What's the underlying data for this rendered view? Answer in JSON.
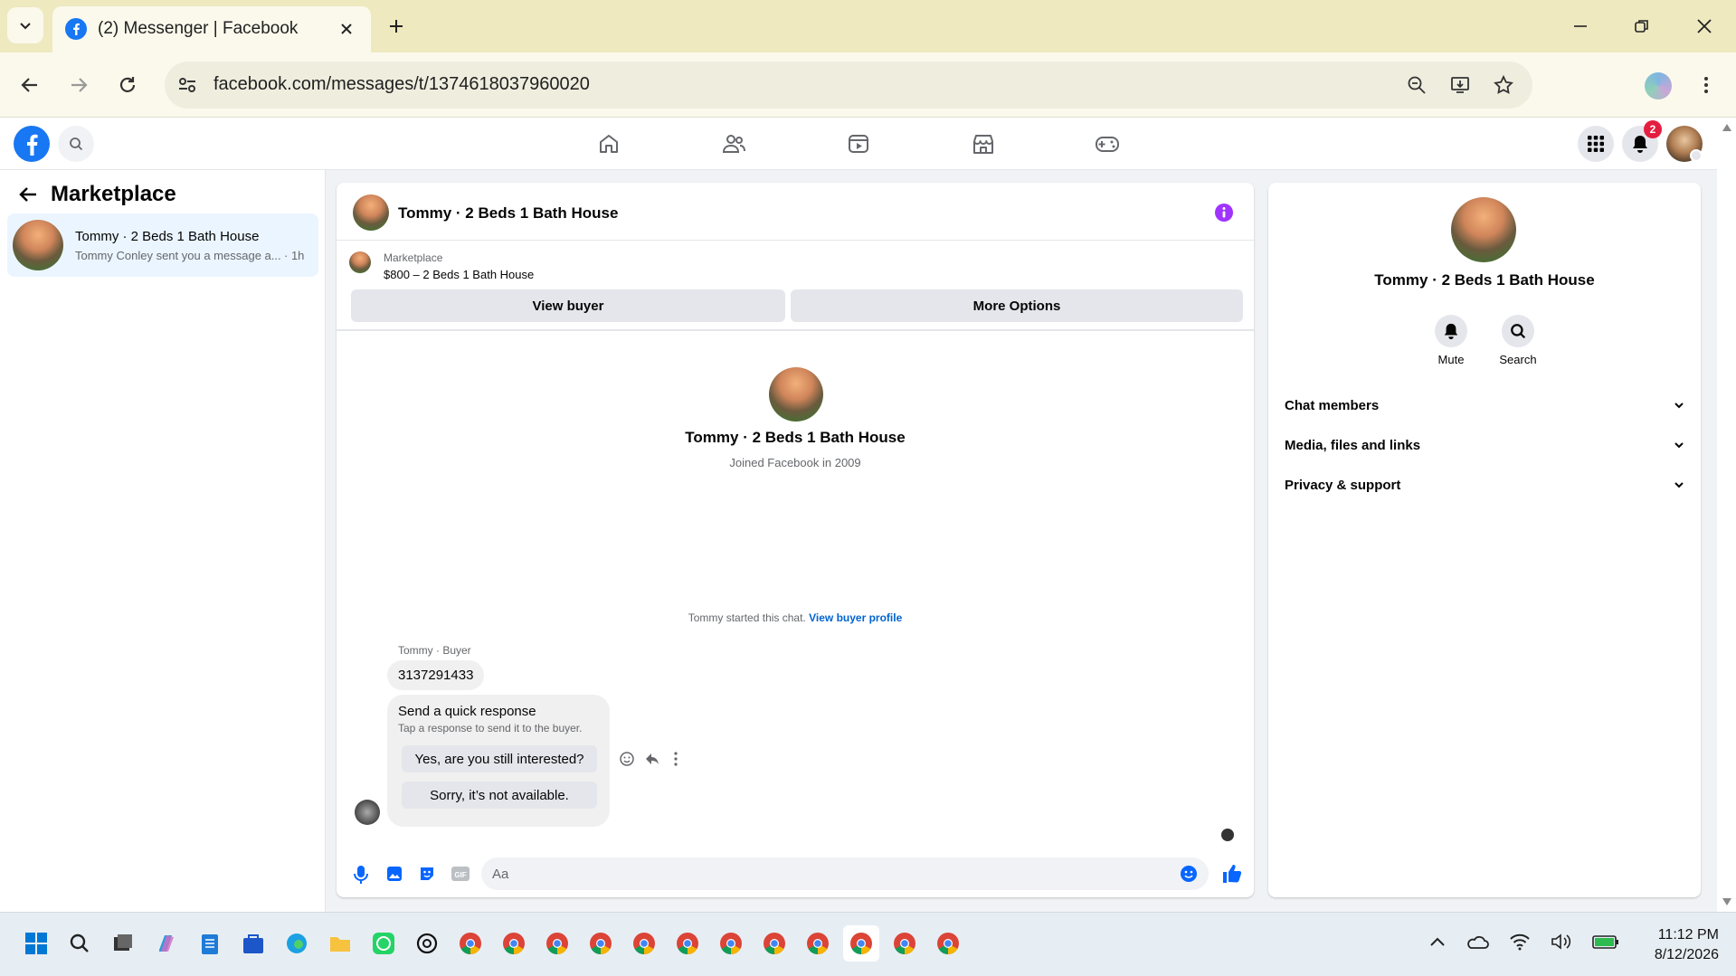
{
  "browser": {
    "tab_title": "(2) Messenger | Facebook",
    "url": "facebook.com/messages/t/1374618037960020"
  },
  "header": {
    "notifications_count": "2"
  },
  "left": {
    "title": "Marketplace",
    "chat": {
      "name": "Tommy · 2 Beds 1 Bath House",
      "preview": "Tommy Conley sent you a message a...",
      "time": "· 1h"
    }
  },
  "chat": {
    "title": "Tommy · 2 Beds 1 Bath House",
    "listing_label": "Marketplace",
    "listing_title": "$800 – 2 Beds 1 Bath House",
    "view_buyer": "View buyer",
    "more_options": "More Options",
    "profile_name": "Tommy · 2 Beds 1 Bath House",
    "joined": "Joined Facebook in 2009",
    "started": "Tommy started this chat.",
    "view_buyer_profile": "View buyer profile",
    "sender": "Tommy · Buyer",
    "message": "3137291433",
    "quick_title": "Send a quick response",
    "quick_sub": "Tap a response to send it to the buyer.",
    "quick_1": "Yes, are you still interested?",
    "quick_2": "Sorry, it’s not available.",
    "input_placeholder": "Aa"
  },
  "right": {
    "name": "Tommy · 2 Beds 1 Bath House",
    "mute": "Mute",
    "search": "Search",
    "sections": [
      "Chat members",
      "Media, files and links",
      "Privacy & support"
    ]
  },
  "taskbar": {
    "time": "11:12 PM",
    "date": "8/12/2026"
  },
  "colors": {
    "fb_blue": "#1877f2",
    "purple_info": "#a033ff",
    "title_bar": "#eee9bf"
  }
}
